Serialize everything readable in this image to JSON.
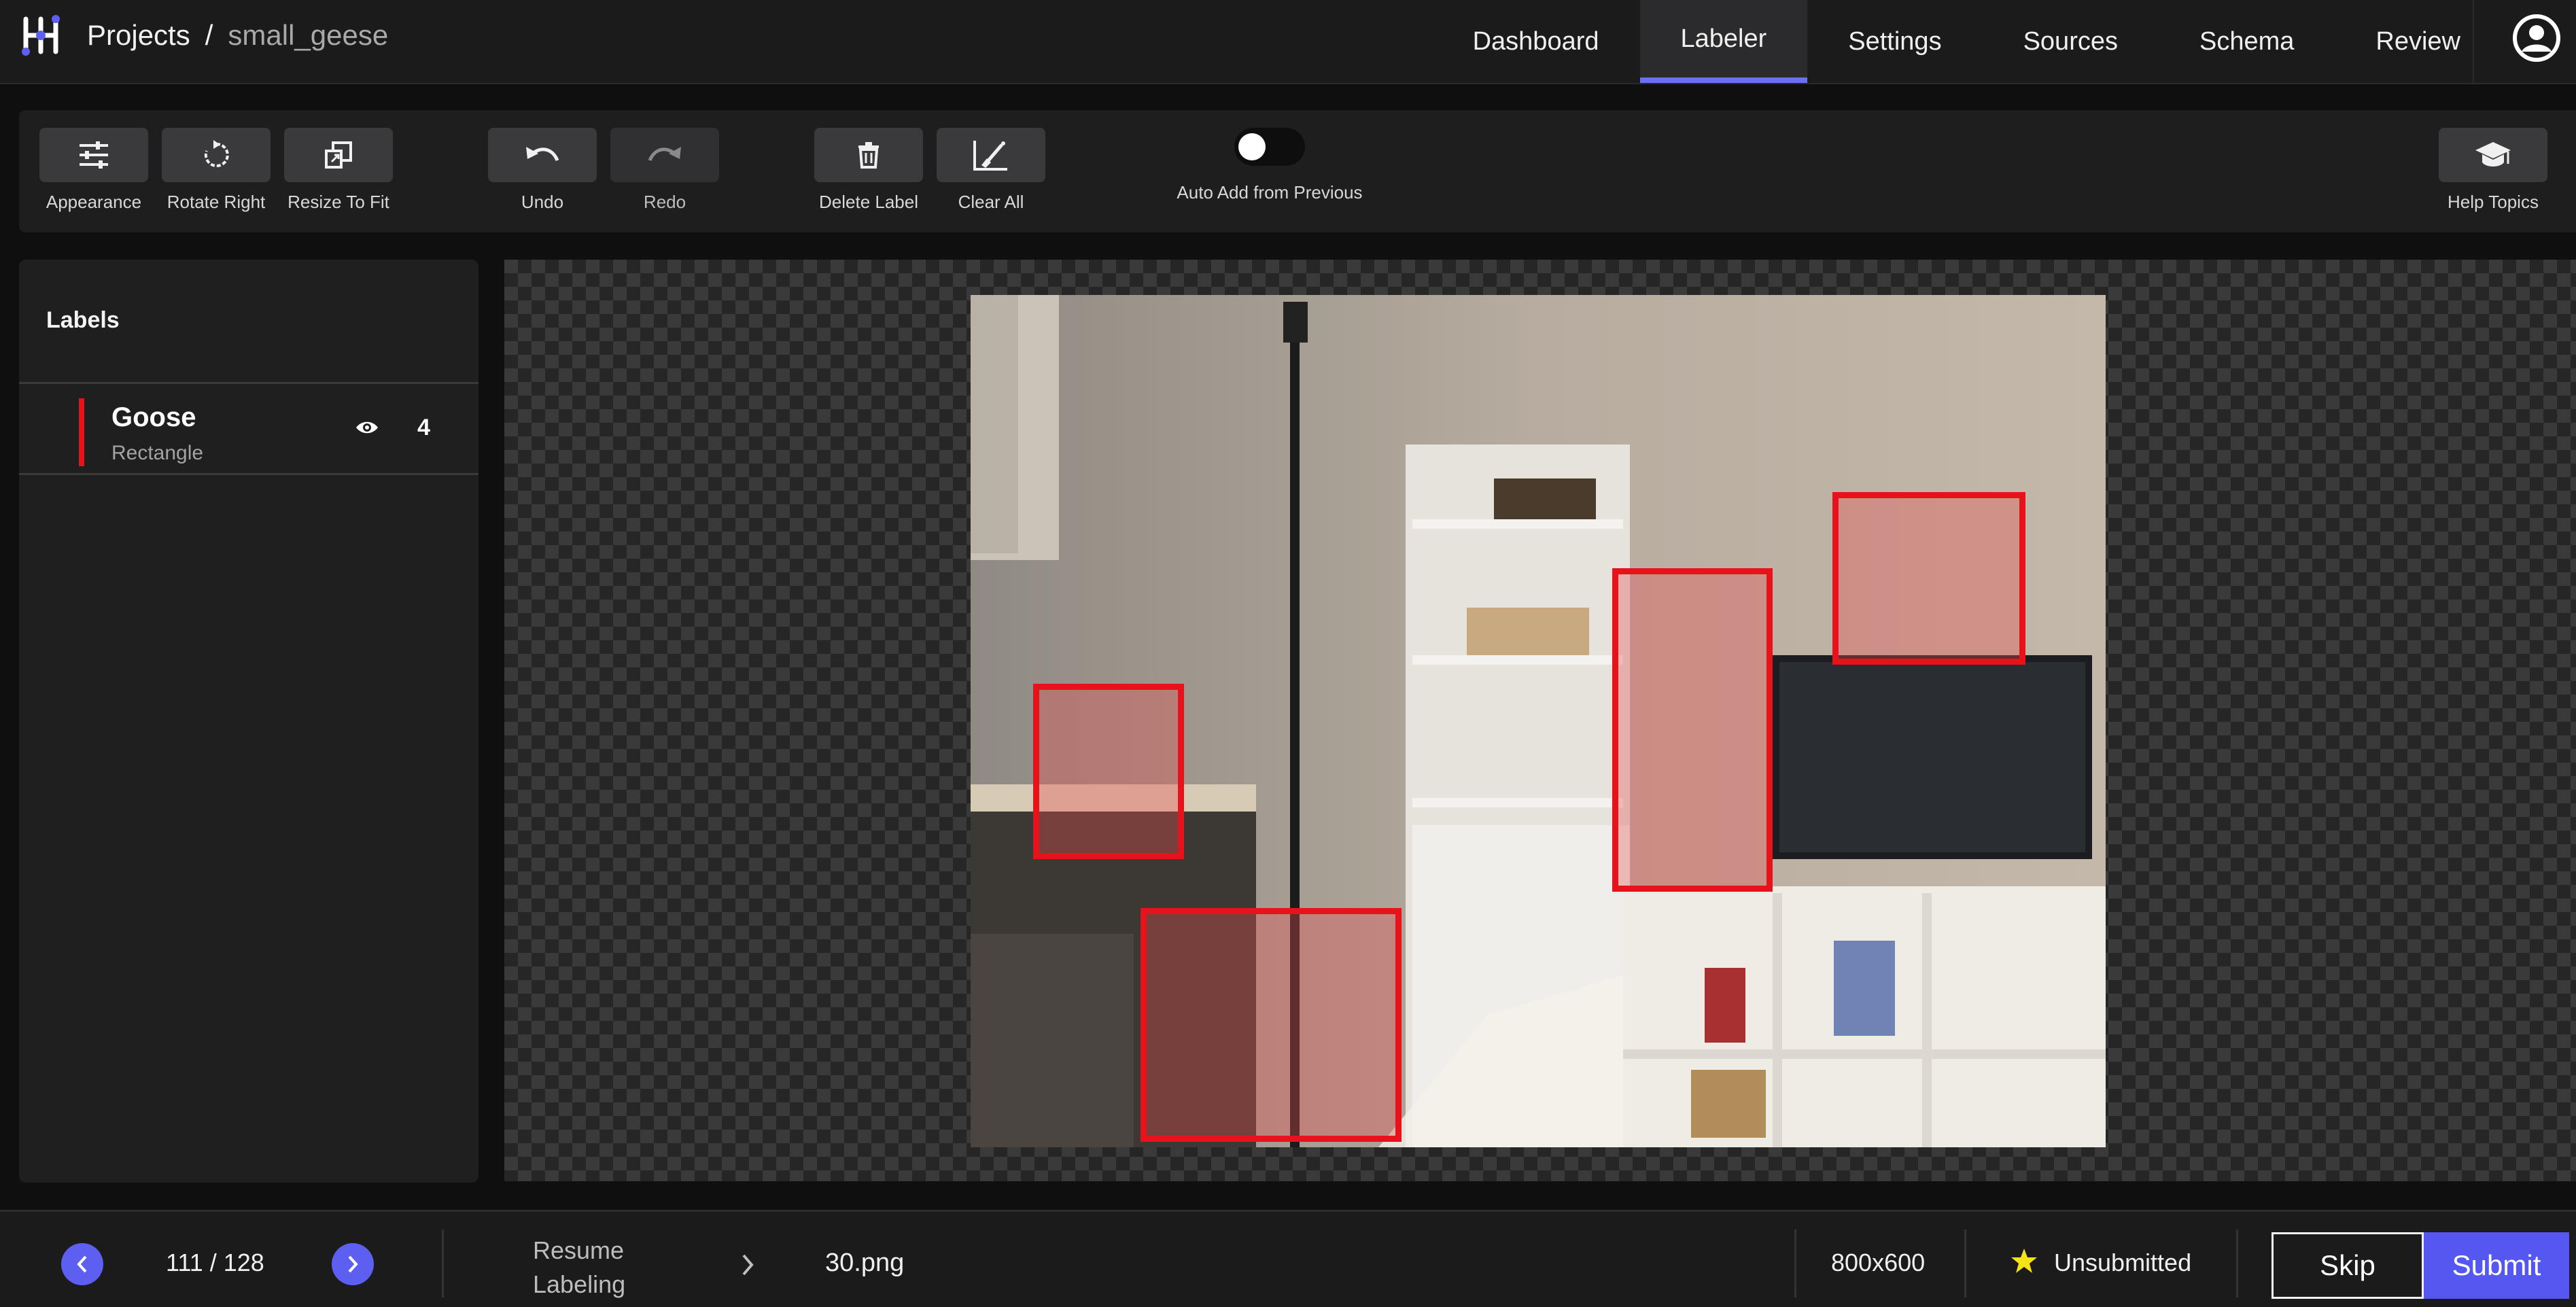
{
  "header": {
    "breadcrumb_root": "Projects",
    "breadcrumb_separator": "/",
    "project_name": "small_geese",
    "nav": [
      {
        "label": "Dashboard",
        "active": false
      },
      {
        "label": "Labeler",
        "active": true
      },
      {
        "label": "Settings",
        "active": false
      },
      {
        "label": "Sources",
        "active": false
      },
      {
        "label": "Schema",
        "active": false
      },
      {
        "label": "Review",
        "active": false
      }
    ],
    "icons": {
      "logo": "app-logo-icon",
      "account": "account-circle-icon"
    }
  },
  "toolbar": {
    "appearance": "Appearance",
    "rotate_right": "Rotate Right",
    "resize_to_fit": "Resize To Fit",
    "undo": "Undo",
    "redo": "Redo",
    "delete_label": "Delete Label",
    "clear_all": "Clear All",
    "auto_add": "Auto Add from Previous",
    "auto_add_enabled": false,
    "help_topics": "Help Topics"
  },
  "labels_panel": {
    "title": "Labels",
    "items": [
      {
        "name": "Goose",
        "type": "Rectangle",
        "count": "4",
        "color": "#e8121b",
        "visible": true
      }
    ]
  },
  "canvas": {
    "annotation_color": "#e8121b",
    "annotations": [
      {
        "label": "Goose"
      },
      {
        "label": "Goose"
      },
      {
        "label": "Goose"
      },
      {
        "label": "Goose"
      }
    ]
  },
  "footer": {
    "counter": "111 / 128",
    "resume_line1": "Resume",
    "resume_line2": "Labeling",
    "filename": "30.png",
    "dimensions": "800x600",
    "status": "Unsubmitted",
    "skip": "Skip",
    "submit": "Submit",
    "accent_color": "#5c5ff0"
  }
}
